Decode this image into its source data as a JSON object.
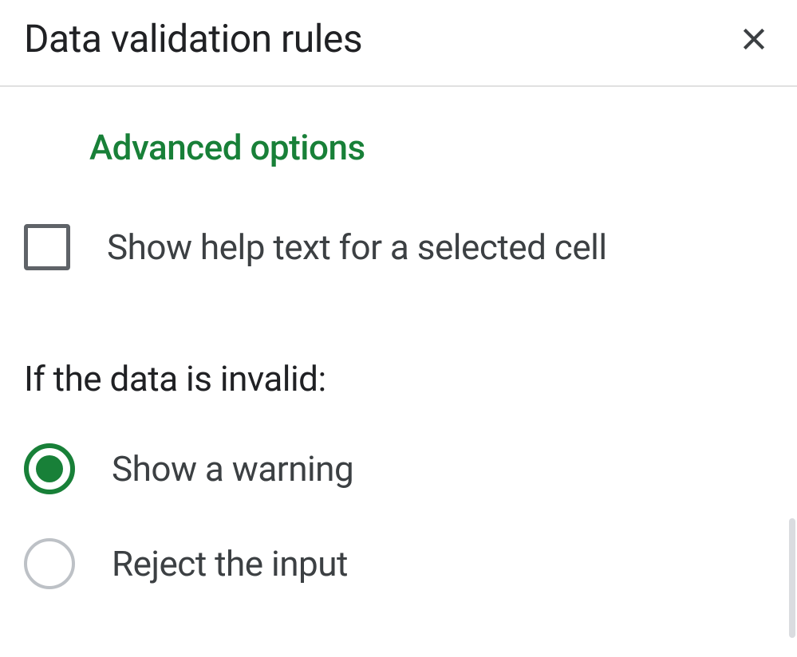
{
  "header": {
    "title": "Data validation rules"
  },
  "advanced_options_label": "Advanced options",
  "show_help_text_label": "Show help text for a selected cell",
  "invalid_data_heading": "If the data is invalid:",
  "radio_options": {
    "show_warning": "Show a warning",
    "reject_input": "Reject the input"
  }
}
